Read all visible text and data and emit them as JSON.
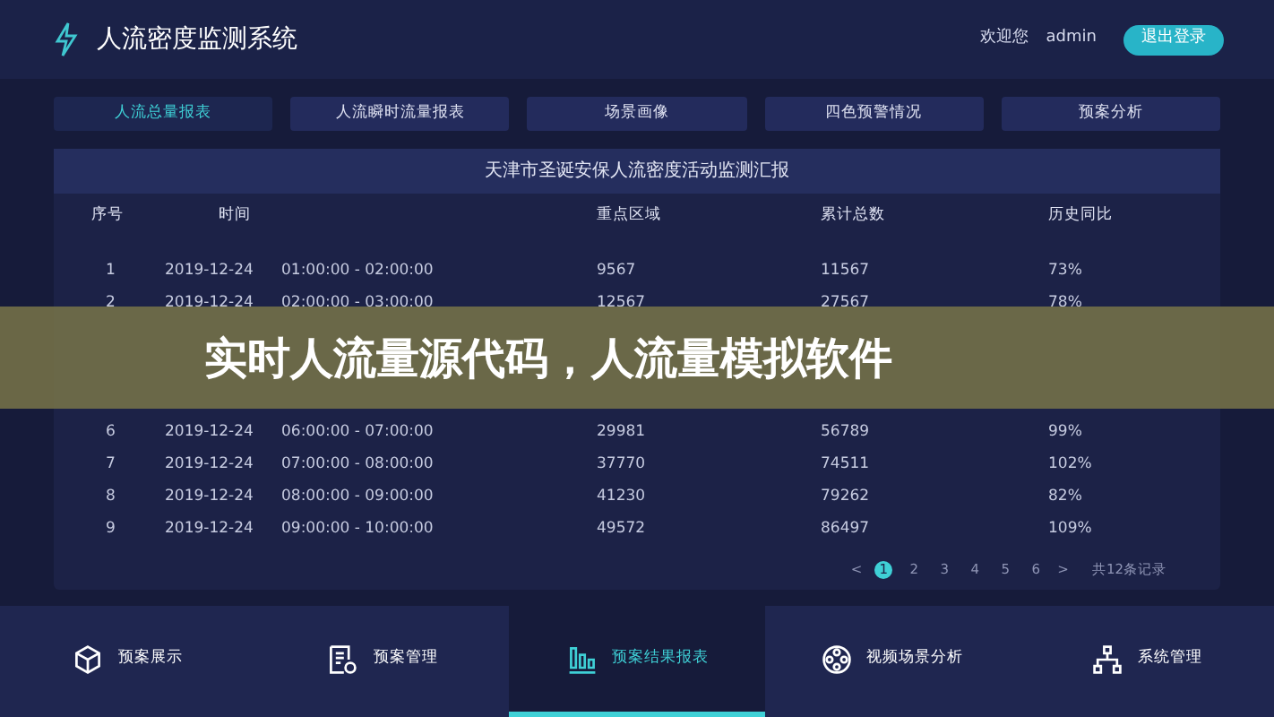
{
  "header": {
    "title": "人流密度监测系统",
    "welcome": "欢迎您",
    "user": "admin",
    "logout": "退出登录"
  },
  "tabs": [
    {
      "label": "人流总量报表",
      "selected": true
    },
    {
      "label": "人流瞬时流量报表",
      "selected": false
    },
    {
      "label": "场景画像",
      "selected": false
    },
    {
      "label": "四色预警情况",
      "selected": false
    },
    {
      "label": "预案分析",
      "selected": false
    }
  ],
  "table": {
    "title": "天津市圣诞安保人流密度活动监测汇报",
    "columns": [
      "序号",
      "时间",
      "重点区域",
      "累计总数",
      "历史同比"
    ],
    "rows_above_banner": [
      [
        "1",
        "2019-12-24",
        "01:00:00 - 02:00:00",
        "9567",
        "11567",
        "73%"
      ],
      [
        "2",
        "2019-12-24",
        "02:00:00 - 03:00:00",
        "12567",
        "27567",
        "78%"
      ]
    ],
    "rows_below_banner": [
      [
        "6",
        "2019-12-24",
        "06:00:00 - 07:00:00",
        "29981",
        "56789",
        "99%"
      ],
      [
        "7",
        "2019-12-24",
        "07:00:00 - 08:00:00",
        "37770",
        "74511",
        "102%"
      ],
      [
        "8",
        "2019-12-24",
        "08:00:00 - 09:00:00",
        "41230",
        "79262",
        "82%"
      ],
      [
        "9",
        "2019-12-24",
        "09:00:00 - 10:00:00",
        "49572",
        "86497",
        "109%"
      ]
    ]
  },
  "pagination": {
    "prev": "<",
    "pages": [
      {
        "label": "1",
        "selected": true
      },
      {
        "label": "2",
        "selected": false
      },
      {
        "label": "3",
        "selected": false
      },
      {
        "label": "4",
        "selected": false
      },
      {
        "label": "5",
        "selected": false
      },
      {
        "label": "6",
        "selected": false
      }
    ],
    "next": ">",
    "total": "共12条记录"
  },
  "banner": "实时人流量源代码，人流量模拟软件",
  "bottom_nav": [
    {
      "label": "预案展示",
      "kind": "cube",
      "selected": false
    },
    {
      "label": "预案管理",
      "kind": "doc",
      "selected": false
    },
    {
      "label": "预案结果报表",
      "kind": "bars",
      "selected": true
    },
    {
      "label": "视频场景分析",
      "kind": "reel",
      "selected": false
    },
    {
      "label": "系统管理",
      "kind": "tree",
      "selected": false
    }
  ]
}
